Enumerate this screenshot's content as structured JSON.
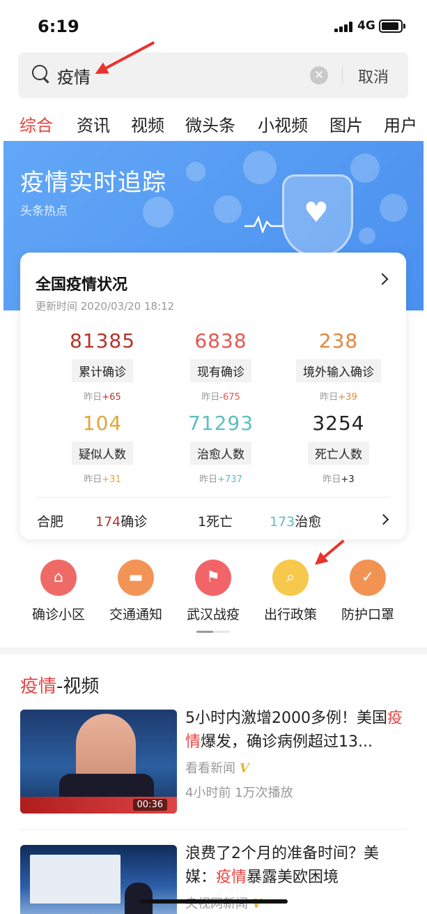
{
  "status_bar": {
    "time": "6:19",
    "network": "4G"
  },
  "search": {
    "query": "疫情",
    "cancel_label": "取消",
    "clear_icon": "clear-icon"
  },
  "tabs": [
    "综合",
    "资讯",
    "视频",
    "微头条",
    "小视频",
    "图片",
    "用户"
  ],
  "active_tab": "综合",
  "banner": {
    "title": "疫情实时追踪",
    "subtitle": "头条热点"
  },
  "stats_card": {
    "title": "全国疫情状况",
    "updated": "更新时间 2020/03/20 18:12",
    "yesterday_label": "昨日",
    "items": [
      {
        "value": "81385",
        "label": "累计确诊",
        "delta": "+65",
        "color": "#b8322c"
      },
      {
        "value": "6838",
        "label": "现有确诊",
        "delta": "-675",
        "color": "#e4574e"
      },
      {
        "value": "238",
        "label": "境外输入确诊",
        "delta": "+39",
        "color": "#e7853b"
      },
      {
        "value": "104",
        "label": "疑似人数",
        "delta": "+31",
        "color": "#e3a43a"
      },
      {
        "value": "71293",
        "label": "治愈人数",
        "delta": "+737",
        "color": "#5cbec2"
      },
      {
        "value": "3254",
        "label": "死亡人数",
        "delta": "+3",
        "color": "#222222"
      }
    ],
    "city": {
      "name": "合肥",
      "confirmed_num": "174",
      "confirmed_label": "确诊",
      "deaths_num": "1",
      "deaths_label": "死亡",
      "cured_num": "173",
      "cured_label": "治愈"
    }
  },
  "features": [
    {
      "label": "确诊小区",
      "icon": "house-pin-icon",
      "color": "#ef6a66"
    },
    {
      "label": "交通通知",
      "icon": "car-icon",
      "color": "#f49356"
    },
    {
      "label": "武汉战疫",
      "icon": "flag-icon",
      "color": "#f16468"
    },
    {
      "label": "出行政策",
      "icon": "search-icon",
      "color": "#f6c84b"
    },
    {
      "label": "防护口罩",
      "icon": "shield-check-icon",
      "color": "#f29353"
    }
  ],
  "video_section": {
    "title_highlight": "疫情",
    "title_rest": "-视频"
  },
  "videos": [
    {
      "title_pre": "5小时内激增2000多例！美国",
      "title_highlight": "疫情",
      "title_post": "爆发，确诊病例超过13...",
      "source": "看看新闻",
      "verified": "V",
      "meta": "4小时前  1万次播放",
      "duration": "00:36"
    },
    {
      "title_pre": "浪费了2个月的准备时间？美媒：",
      "title_highlight": "疫情",
      "title_post": "暴露美欧困境",
      "source": "央视网新闻",
      "verified": "V",
      "meta": "",
      "duration": ""
    }
  ]
}
